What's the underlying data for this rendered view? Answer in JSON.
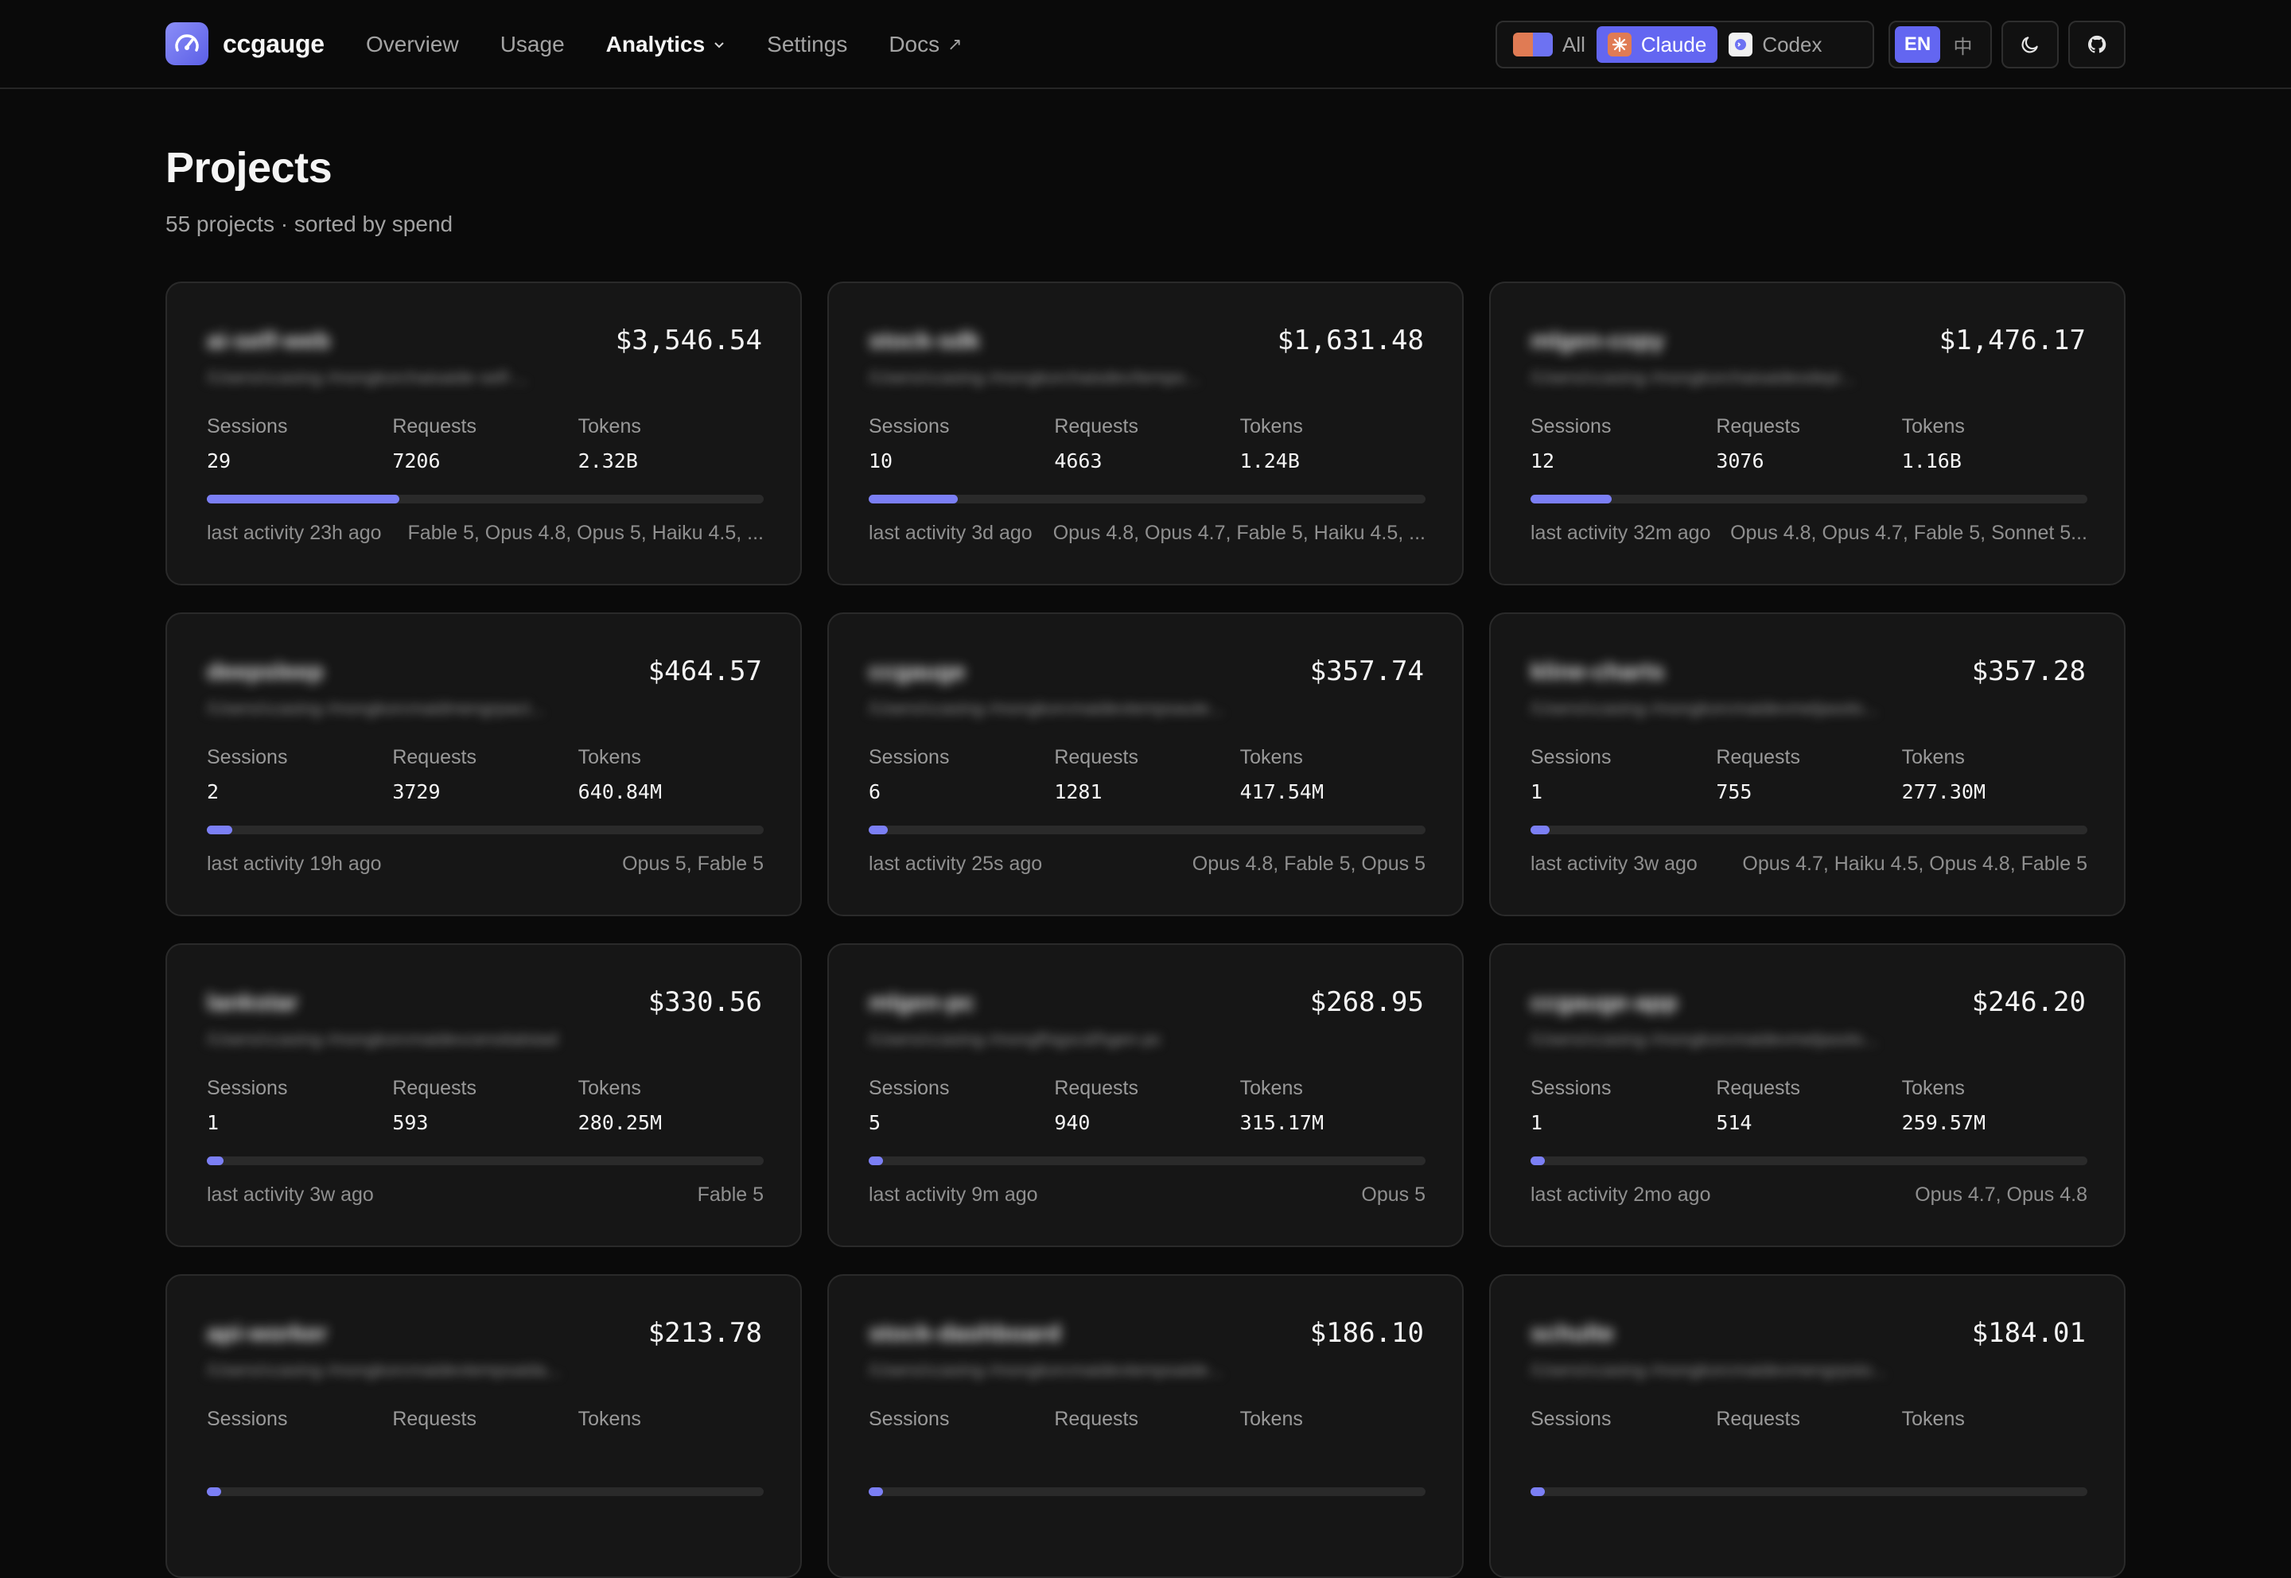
{
  "app": {
    "name": "ccgauge",
    "nav": [
      "Overview",
      "Usage",
      "Analytics",
      "Settings",
      "Docs"
    ],
    "source_filter": [
      "All",
      "Claude",
      "Codex"
    ],
    "source_selected": "Claude",
    "languages": [
      "EN",
      "中"
    ],
    "language_selected": "EN",
    "accent_color": "#6366f1"
  },
  "page": {
    "title": "Projects",
    "subtitle": "55 projects · sorted by spend"
  },
  "labels": {
    "sessions": "Sessions",
    "requests": "Requests",
    "tokens": "Tokens"
  },
  "projects": [
    {
      "name": "ai-self-web",
      "path": "/Users/ccasing-/mongkorchaisaide-self-...",
      "cost": "$3,546.54",
      "sessions": "29",
      "requests": "7206",
      "tokens": "2.32B",
      "spend_share": 0.345,
      "activity": "last activity 23h ago",
      "models": "Fable 5, Opus 4.8, Opus 5, Haiku 4.5, ..."
    },
    {
      "name": "stock-sdk",
      "path": "/Users/ccasing-/mongkorchaisdev/tempo...",
      "cost": "$1,631.48",
      "sessions": "10",
      "requests": "4663",
      "tokens": "1.24B",
      "spend_share": 0.16,
      "activity": "last activity 3d ago",
      "models": "Opus 4.8, Opus 4.7, Fable 5, Haiku 4.5, ..."
    },
    {
      "name": "mlgen-copy",
      "path": "/Users/ccasing-/mongkorchaisaidesdepi...",
      "cost": "$1,476.17",
      "sessions": "12",
      "requests": "3076",
      "tokens": "1.16B",
      "spend_share": 0.145,
      "activity": "last activity 32m ago",
      "models": "Opus 4.8, Opus 4.7, Fable 5, Sonnet 5..."
    },
    {
      "name": "deepsleep",
      "path": "/Users/ccasing-/mongkorcmaidmengrpact...",
      "cost": "$464.57",
      "sessions": "2",
      "requests": "3729",
      "tokens": "640.84M",
      "spend_share": 0.045,
      "activity": "last activity 19h ago",
      "models": "Opus 5, Fable 5"
    },
    {
      "name": "ccgauge",
      "path": "/Users/ccasing-/mongkorcmaidevtempsaute...",
      "cost": "$357.74",
      "sessions": "6",
      "requests": "1281",
      "tokens": "417.54M",
      "spend_share": 0.034,
      "activity": "last activity 25s ago",
      "models": "Opus 4.8, Fable 5, Opus 5"
    },
    {
      "name": "kline-charts",
      "path": "/Users/ccasing-/mongkorcmaidevmeljasolo...",
      "cost": "$357.28",
      "sessions": "1",
      "requests": "755",
      "tokens": "277.30M",
      "spend_share": 0.034,
      "activity": "last activity 3w ago",
      "models": "Opus 4.7, Haiku 4.5, Opus 4.8, Fable 5"
    },
    {
      "name": "lankstar",
      "path": "/Users/ccasing-/mongkorcmaidevcensitalstad",
      "cost": "$330.56",
      "sessions": "1",
      "requests": "593",
      "tokens": "280.25M",
      "spend_share": 0.03,
      "activity": "last activity 3w ago",
      "models": "Fable 5"
    },
    {
      "name": "mlgen-pc",
      "path": "/Users/ccasing-/mongfhigscd/hgen-pc",
      "cost": "$268.95",
      "sessions": "5",
      "requests": "940",
      "tokens": "315.17M",
      "spend_share": 0.026,
      "activity": "last activity 9m ago",
      "models": "Opus 5"
    },
    {
      "name": "ccgauge-app",
      "path": "/Users/ccasing-/mongkorcmaidevmeljasolo...",
      "cost": "$246.20",
      "sessions": "1",
      "requests": "514",
      "tokens": "259.57M",
      "spend_share": 0.024,
      "activity": "last activity 2mo ago",
      "models": "Opus 4.7, Opus 4.8"
    },
    {
      "name": "api-worker",
      "path": "/Users/ccasing-/mongkorcmaidevtempsaida...",
      "cost": "$213.78",
      "sessions": "",
      "requests": "",
      "tokens": "",
      "spend_share": 0.02,
      "activity": "",
      "models": ""
    },
    {
      "name": "stock-dashboard",
      "path": "/Users/ccasing-/mongkorcmaidevtempsaide...",
      "cost": "$186.10",
      "sessions": "",
      "requests": "",
      "tokens": "",
      "spend_share": 0.018,
      "activity": "",
      "models": ""
    },
    {
      "name": "schulte",
      "path": "/Users/ccasing-/mongkorcmaidevmengrpsto...",
      "cost": "$184.01",
      "sessions": "",
      "requests": "",
      "tokens": "",
      "spend_share": 0.018,
      "activity": "",
      "models": ""
    }
  ]
}
